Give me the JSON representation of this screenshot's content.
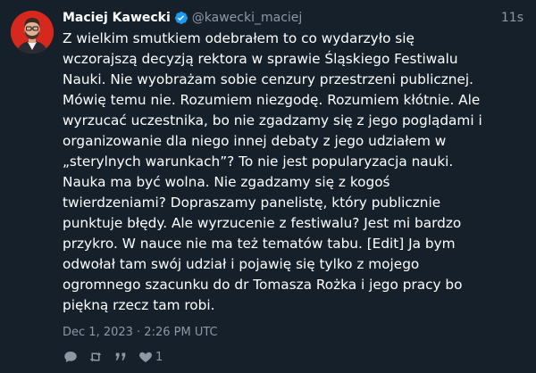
{
  "author": {
    "name": "Maciej Kawecki",
    "handle": "@kawecki_maciej",
    "verified_icon": "verified-badge-icon"
  },
  "time_ago": "11s",
  "text": "Z wielkim smutkiem odebrałem to co wydarzyło się\nwczorajszą decyzją rektora w sprawie Śląskiego Festiwalu\nNauki. Nie wyobrażam sobie cenzury przestrzeni publicznej.\nMówię temu nie. Rozumiem niezgodę. Rozumiem kłótnie. Ale\nwyrzucać uczestnika, bo nie zgadzamy się z jego poglądami i\norganizowanie dla niego innej debaty z jego udziałem w\n„sterylnych warunkach”? To nie jest popularyzacja nauki.\nNauka ma być wolna. Nie zgadzamy się z kogoś\ntwierdzeniami? Dopraszamy panelistę, który publicznie\npunktuje błędy. Ale wyrzucenie z festiwalu? Jest mi bardzo\nprzykro. W nauce nie ma też tematów tabu. [Edit] Ja bym\nodwołał tam swój udział i pojawię się tylko z mojego\nogromnego szacunku do dr Tomasza Rożka i jego pracy bo\npiękną rzecz tam robi.",
  "timestamp": "Dec 1, 2023 · 2:26 PM UTC",
  "actions": {
    "reply_icon": "reply-icon",
    "retweet_icon": "retweet-icon",
    "quote_icon": "quote-icon",
    "like_icon": "heart-icon",
    "like_count": "1"
  },
  "colors": {
    "background": "#15202b",
    "text": "#ffffff",
    "secondary": "#8b98a5",
    "verified": "#1d9bf0",
    "avatar_bg": "#d7281e"
  }
}
